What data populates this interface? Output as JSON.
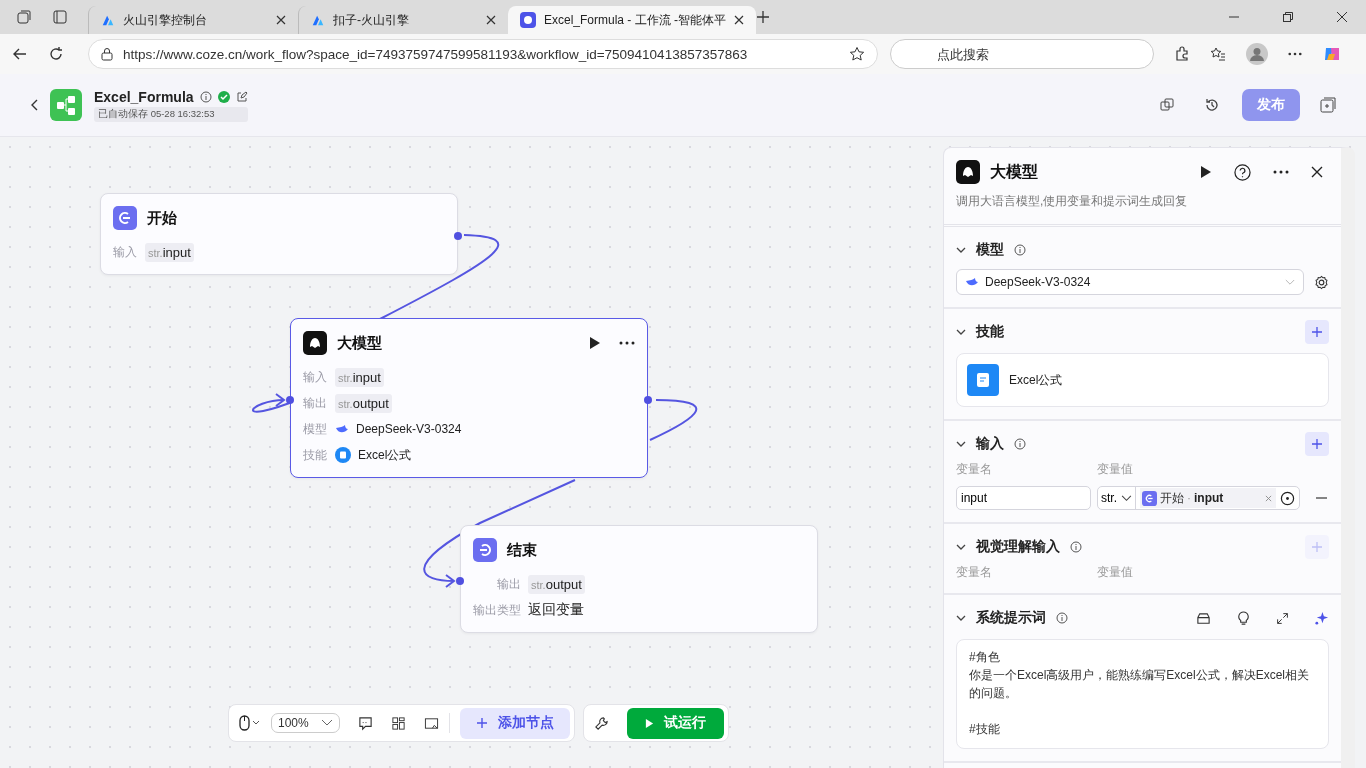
{
  "browser": {
    "tabs": [
      {
        "title": "火山引擎控制台",
        "selected": false
      },
      {
        "title": "扣子-火山引擎",
        "selected": false
      },
      {
        "title": "Excel_Formula - 工作流 -智能体平",
        "selected": true
      }
    ],
    "url": "https://www.coze.cn/work_flow?space_id=7493759747599581193&workflow_id=7509410413857357863",
    "search": {
      "placeholder": "点此搜索"
    }
  },
  "header": {
    "title": "Excel_Formula",
    "saved": "已自动保存 05-28 16:32:53",
    "publish": {
      "label": "发布",
      "disabled": true
    }
  },
  "nodes": [
    {
      "kind": "start",
      "title": "开始",
      "selected": false,
      "rows": [
        {
          "kind": "var",
          "label": "输入",
          "type": "str.",
          "value": "input"
        }
      ]
    },
    {
      "kind": "llm",
      "title": "大模型",
      "selected": true,
      "rows": [
        {
          "kind": "var",
          "label": "输入",
          "type": "str.",
          "value": "input"
        },
        {
          "kind": "var",
          "label": "输出",
          "type": "str.",
          "value": "output"
        },
        {
          "kind": "model",
          "label": "模型",
          "value": "DeepSeek-V3-0324"
        },
        {
          "kind": "skill",
          "label": "技能",
          "value": "Excel公式"
        }
      ]
    },
    {
      "kind": "end",
      "title": "结束",
      "selected": false,
      "rows": [
        {
          "kind": "var",
          "label": "输出",
          "type": "str.",
          "value": "output"
        },
        {
          "kind": "text",
          "label": "输出类型",
          "value": "返回变量"
        }
      ]
    }
  ],
  "toolbar": {
    "zoom": "100%",
    "add_node": "添加节点",
    "test_run": "试运行"
  },
  "panel": {
    "title": "大模型",
    "description": "调用大语言模型,使用变量和提示词生成回复",
    "sections": [
      {
        "kind": "model",
        "title": "模型",
        "expanded": true,
        "info": true,
        "value": "DeepSeek-V3-0324"
      },
      {
        "kind": "skills",
        "title": "技能",
        "expanded": true,
        "info": false,
        "add_disabled": false,
        "items": [
          "Excel公式"
        ]
      },
      {
        "kind": "inputs",
        "title": "输入",
        "expanded": true,
        "info": true,
        "add_disabled": false,
        "name_header": "变量名",
        "value_header": "变量值",
        "rows": [
          {
            "name": "input",
            "type": "str.",
            "source": "开始",
            "separator": "·",
            "var": "input"
          }
        ]
      },
      {
        "kind": "inputs",
        "title": "视觉理解输入",
        "expanded": true,
        "info": true,
        "add_disabled": true,
        "name_header": "变量名",
        "value_header": "变量值"
      },
      {
        "kind": "prompt",
        "title": "系统提示词",
        "expanded": true,
        "info": true,
        "paragraphs": [
          [
            "#角色",
            "你是一个Excel高级用户，能熟练编写Excel公式，解决Excel相关的问题。"
          ],
          [
            "#技能"
          ]
        ]
      }
    ]
  }
}
